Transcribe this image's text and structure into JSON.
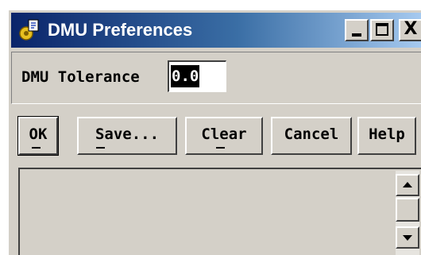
{
  "window": {
    "title": "DMU Preferences",
    "title_gradient": [
      "#0a246a",
      "#a6caf0"
    ],
    "face_color": "#d4d0c8",
    "controls": {
      "minimize_icon": "minimize-icon",
      "maximize_icon": "maximize-icon",
      "close_glyph": "X"
    }
  },
  "tolerance": {
    "label": "DMU Tolerance",
    "value": "0.0"
  },
  "buttons": {
    "ok": "OK",
    "save": "Save...",
    "clear": "Clear",
    "cancel": "Cancel",
    "help": "Help"
  },
  "output": {
    "scroll_up_icon": "arrow-up-icon",
    "scroll_down_icon": "arrow-down-icon"
  }
}
